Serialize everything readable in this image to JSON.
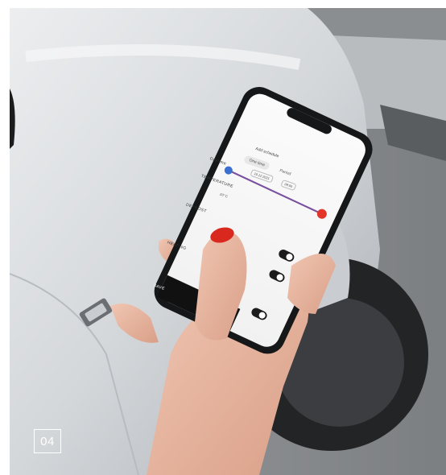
{
  "badge": {
    "text": "04"
  },
  "phone_screen": {
    "title": "Add schedule",
    "tabs": [
      {
        "label": "One time",
        "active": true
      },
      {
        "label": "Period",
        "active": false
      }
    ],
    "row_daytime": "Daytime",
    "date_pill": "10.12.2021",
    "time_pill": "09:00",
    "section_temperature": "TEMPERATURE",
    "temperature_value": "20°C",
    "section_defrost": "DEFROST",
    "section_heating": "HEATING",
    "button_save": "SAVE"
  },
  "colors": {
    "slider_start": "#3b6fd1",
    "slider_end": "#e2362b",
    "car_body": "#d7dadd",
    "skin": "#e7b8a3",
    "nail": "#d9291e",
    "save_button": "#111111"
  }
}
